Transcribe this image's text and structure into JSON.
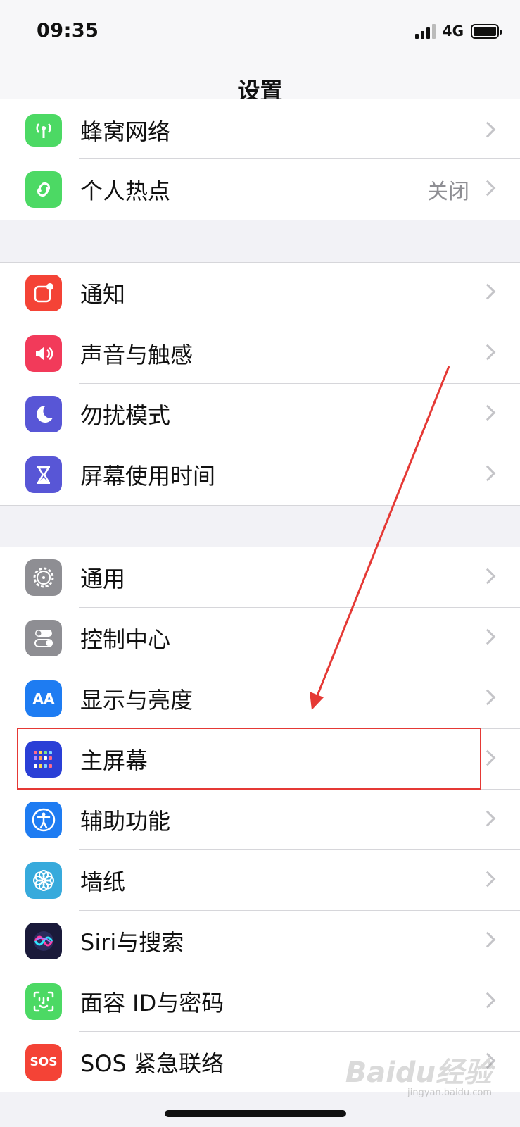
{
  "status_bar": {
    "time": "09:35",
    "network": "4G"
  },
  "nav": {
    "title": "设置"
  },
  "groups": [
    {
      "rows": [
        {
          "label": "蜂窝网络",
          "detail": "",
          "icon": "antenna-icon",
          "icon_color": "#4cd964"
        },
        {
          "label": "个人热点",
          "detail": "关闭",
          "icon": "hotspot-link-icon",
          "icon_color": "#4cd964"
        }
      ]
    },
    {
      "rows": [
        {
          "label": "通知",
          "detail": "",
          "icon": "notification-icon",
          "icon_color": "#f44336"
        },
        {
          "label": "声音与触感",
          "detail": "",
          "icon": "speaker-icon",
          "icon_color": "#f23a5a"
        },
        {
          "label": "勿扰模式",
          "detail": "",
          "icon": "moon-icon",
          "icon_color": "#5856d6"
        },
        {
          "label": "屏幕使用时间",
          "detail": "",
          "icon": "hourglass-icon",
          "icon_color": "#5856d6"
        }
      ]
    },
    {
      "rows": [
        {
          "label": "通用",
          "detail": "",
          "icon": "gear-icon",
          "icon_color": "#8e8e93"
        },
        {
          "label": "控制中心",
          "detail": "",
          "icon": "toggles-icon",
          "icon_color": "#8e8e93"
        },
        {
          "label": "显示与亮度",
          "detail": "",
          "icon": "text-size-icon",
          "icon_color": "#1e7cf2",
          "icon_text": "AA"
        },
        {
          "label": "主屏幕",
          "detail": "",
          "icon": "home-screen-grid-icon",
          "icon_color": "#2a3fd6"
        },
        {
          "label": "辅助功能",
          "detail": "",
          "icon": "accessibility-icon",
          "icon_color": "#1e7cf2"
        },
        {
          "label": "墙纸",
          "detail": "",
          "icon": "flower-icon",
          "icon_color": "#37aadc"
        },
        {
          "label": "Siri与搜索",
          "detail": "",
          "icon": "siri-icon",
          "icon_color": "#1a1a3a"
        },
        {
          "label": "面容 ID与密码",
          "detail": "",
          "icon": "face-id-icon",
          "icon_color": "#4cd964"
        },
        {
          "label": "SOS 紧急联络",
          "detail": "",
          "icon": "sos-icon",
          "icon_color": "#f44336",
          "icon_text": "SOS"
        }
      ]
    }
  ],
  "annotation": {
    "highlight_color": "#e53935"
  },
  "watermark": {
    "text": "Baidu经验",
    "sub": "jingyan.baidu.com"
  }
}
